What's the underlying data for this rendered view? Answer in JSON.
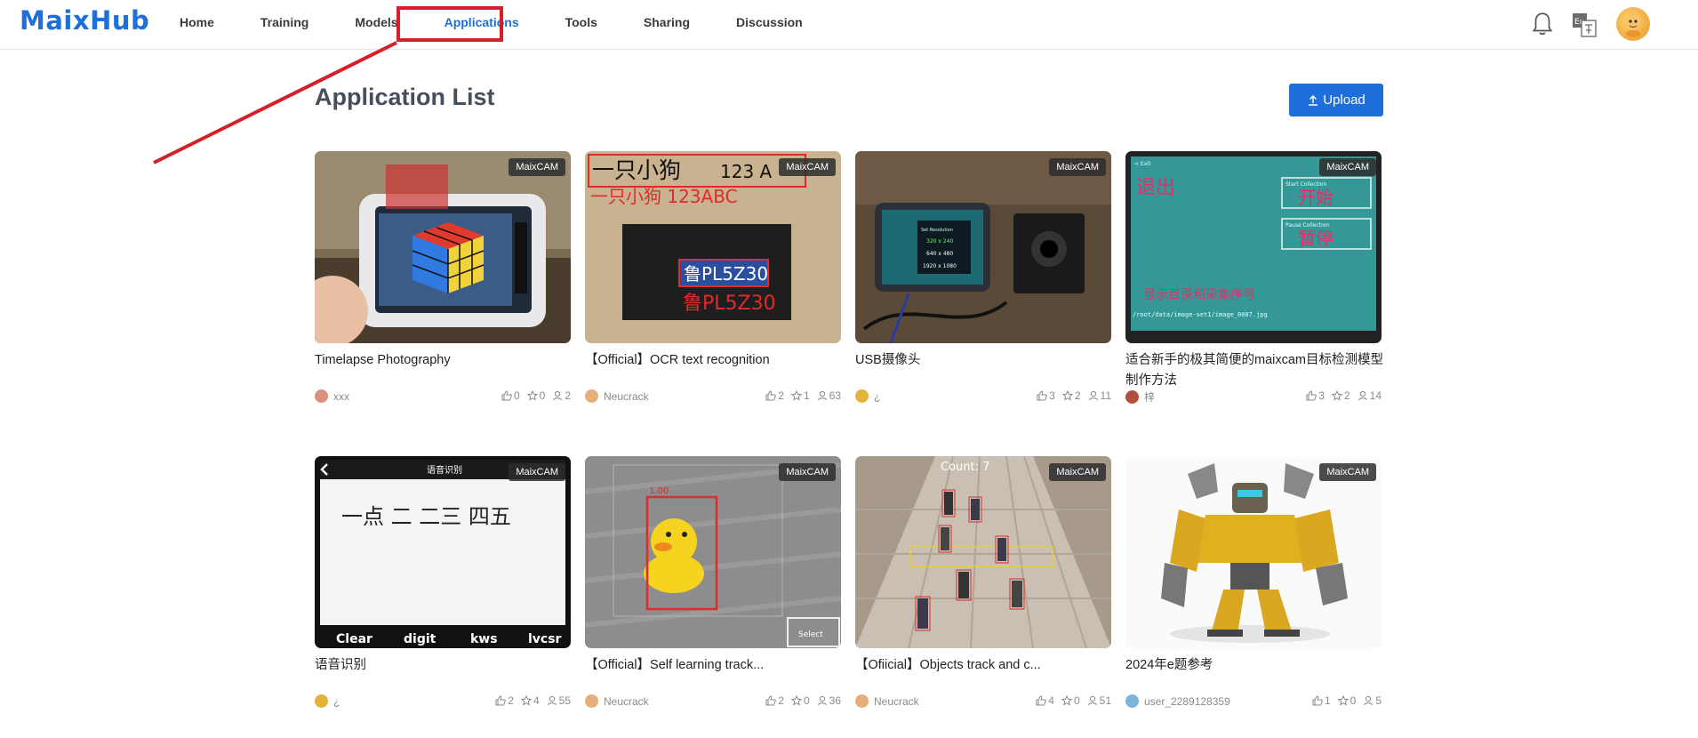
{
  "header": {
    "logo": "MaixHub",
    "nav": [
      "Home",
      "Training",
      "Models",
      "Applications",
      "Tools",
      "Sharing",
      "Discussion"
    ],
    "active_nav": "Applications",
    "lang_label": "En"
  },
  "page": {
    "title": "Application List",
    "upload_label": "Upload"
  },
  "cards": [
    {
      "title": "Timelapse Photography",
      "tag": "MaixCAM",
      "author": "xxx",
      "likes": "0",
      "stars": "0",
      "downloads": "2"
    },
    {
      "title": "【Official】OCR text recognition",
      "tag": "MaixCAM",
      "author": "Neucrack",
      "likes": "2",
      "stars": "1",
      "downloads": "63"
    },
    {
      "title": "USB摄像头",
      "tag": "MaixCAM",
      "author": "¿",
      "likes": "3",
      "stars": "2",
      "downloads": "11"
    },
    {
      "title": "适合新手的极其简便的maixcam目标检测模型制作方法",
      "tag": "MaixCAM",
      "author": "梓",
      "likes": "3",
      "stars": "2",
      "downloads": "14"
    },
    {
      "title": "语音识别",
      "tag": "MaixCAM",
      "author": "¿",
      "likes": "2",
      "stars": "4",
      "downloads": "55"
    },
    {
      "title": "【Official】Self learning track...",
      "tag": "MaixCAM",
      "author": "Neucrack",
      "likes": "2",
      "stars": "0",
      "downloads": "36"
    },
    {
      "title": "【Ofiicial】Objects track and c...",
      "tag": "MaixCAM",
      "author": "Neucrack",
      "likes": "4",
      "stars": "0",
      "downloads": "51"
    },
    {
      "title": "2024年e题参考",
      "tag": "MaixCAM",
      "author": "user_2289128359",
      "likes": "1",
      "stars": "0",
      "downloads": "5"
    }
  ],
  "thumb_text": {
    "ocr_top": "一只小狗",
    "ocr_top_right": "123 A",
    "ocr_line2": "一只小狗 123ABC",
    "ocr_plate": "鲁PL5Z30",
    "ocr_plate_label": "鲁PL5Z30",
    "usb_lines": [
      "Set Resolution",
      "320 x 240",
      "640 x 480",
      "1920 x 1080"
    ],
    "det_exit": "退出",
    "det_exit_en": "< Exit",
    "det_start": "开始",
    "det_start_en": "Start Collection",
    "det_pause": "暂停",
    "det_pause_en": "Pause Collection",
    "det_info": "显示目录和采集序号",
    "det_path": "/root/data/image-set1/image_0087.jpg",
    "speech_header": "语音识别",
    "speech_text": "一点 二 二三 四五",
    "speech_buttons": [
      "Clear",
      "digit",
      "kws",
      "lvcsr"
    ],
    "track_score": "1.00",
    "track_select": "Select",
    "objects_count": "Count: 7"
  },
  "colors": {
    "primary": "#1e6fd9",
    "highlight": "#d5202b"
  },
  "icons": [
    "bell-icon",
    "language-icon",
    "upload-icon",
    "thumb-up-icon",
    "star-icon",
    "download-icon"
  ]
}
